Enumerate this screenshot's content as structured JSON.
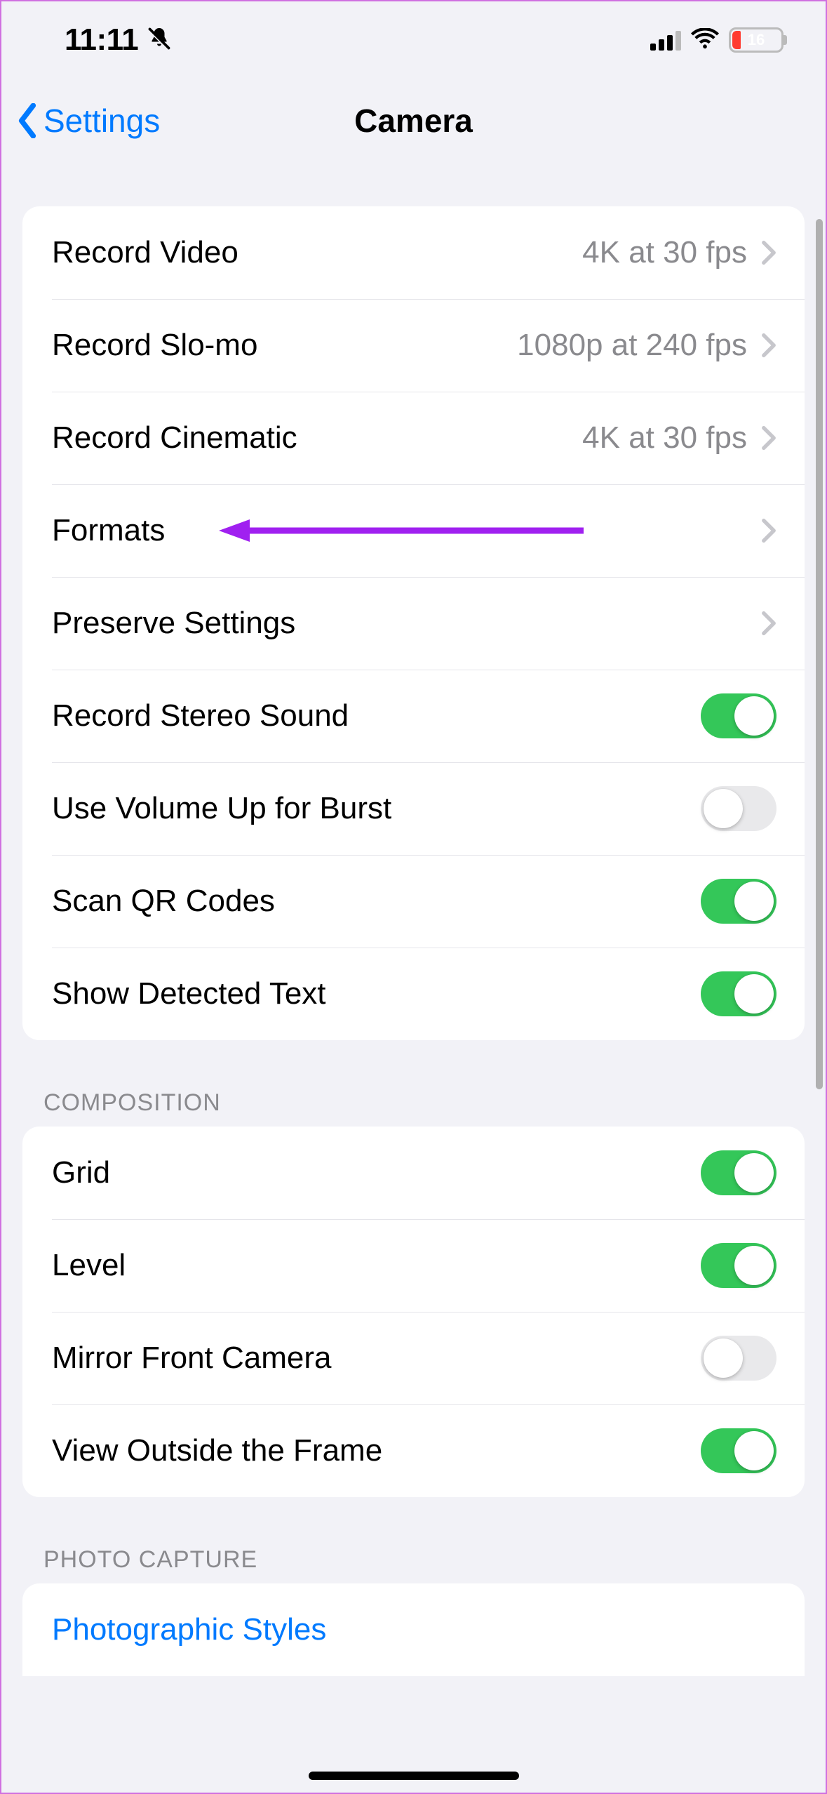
{
  "status": {
    "time": "11:11",
    "silent_icon": "bell-slash-icon",
    "battery_percent": "16"
  },
  "nav": {
    "back_label": "Settings",
    "title": "Camera"
  },
  "sections": {
    "main": [
      {
        "label": "Record Video",
        "value": "4K at 30 fps",
        "type": "disclosure"
      },
      {
        "label": "Record Slo-mo",
        "value": "1080p at 240 fps",
        "type": "disclosure"
      },
      {
        "label": "Record Cinematic",
        "value": "4K at 30 fps",
        "type": "disclosure"
      },
      {
        "label": "Formats",
        "value": "",
        "type": "disclosure",
        "annotated": true
      },
      {
        "label": "Preserve Settings",
        "value": "",
        "type": "disclosure"
      },
      {
        "label": "Record Stereo Sound",
        "type": "toggle",
        "on": true
      },
      {
        "label": "Use Volume Up for Burst",
        "type": "toggle",
        "on": false
      },
      {
        "label": "Scan QR Codes",
        "type": "toggle",
        "on": true
      },
      {
        "label": "Show Detected Text",
        "type": "toggle",
        "on": true
      }
    ],
    "composition_header": "COMPOSITION",
    "composition": [
      {
        "label": "Grid",
        "type": "toggle",
        "on": true
      },
      {
        "label": "Level",
        "type": "toggle",
        "on": true
      },
      {
        "label": "Mirror Front Camera",
        "type": "toggle",
        "on": false
      },
      {
        "label": "View Outside the Frame",
        "type": "toggle",
        "on": true
      }
    ],
    "photo_capture_header": "PHOTO CAPTURE",
    "photo_capture": [
      {
        "label": "Photographic Styles",
        "type": "link"
      }
    ]
  },
  "colors": {
    "accent": "#007aff",
    "toggle_on": "#34c759",
    "annotation": "#a020f0",
    "battery_low": "#ff3b30"
  }
}
